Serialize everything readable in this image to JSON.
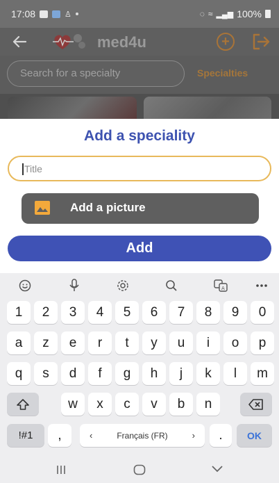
{
  "status": {
    "time": "17:08",
    "battery": "100%"
  },
  "app": {
    "title": "med4u",
    "back_icon": "arrow-left-icon",
    "add_icon": "plus-circle-icon",
    "logout_icon": "logout-icon"
  },
  "search": {
    "placeholder": "Search for a specialty",
    "tab_label": "Specialties"
  },
  "colors": {
    "accent_orange": "#e8932f",
    "primary_blue": "#3f52b5",
    "input_border": "#e8b95b"
  },
  "dialog": {
    "title": "Add a speciality",
    "title_field": {
      "value": "",
      "placeholder": "Title"
    },
    "picture_button": "Add a picture",
    "submit_button": "Add"
  },
  "keyboard": {
    "toolbar": [
      "emoji-icon",
      "microphone-icon",
      "settings-icon",
      "search-icon",
      "translate-icon",
      "more-icon"
    ],
    "rows": [
      [
        "1",
        "2",
        "3",
        "4",
        "5",
        "6",
        "7",
        "8",
        "9",
        "0"
      ],
      [
        "a",
        "z",
        "e",
        "r",
        "t",
        "y",
        "u",
        "i",
        "o",
        "p"
      ],
      [
        "q",
        "s",
        "d",
        "f",
        "g",
        "h",
        "j",
        "k",
        "l",
        "m"
      ],
      [
        "w",
        "x",
        "c",
        "v",
        "b",
        "n"
      ]
    ],
    "symbols_key": "!#1",
    "comma_key": ",",
    "language": "Français (FR)",
    "period_key": ".",
    "ok_key": "OK"
  }
}
